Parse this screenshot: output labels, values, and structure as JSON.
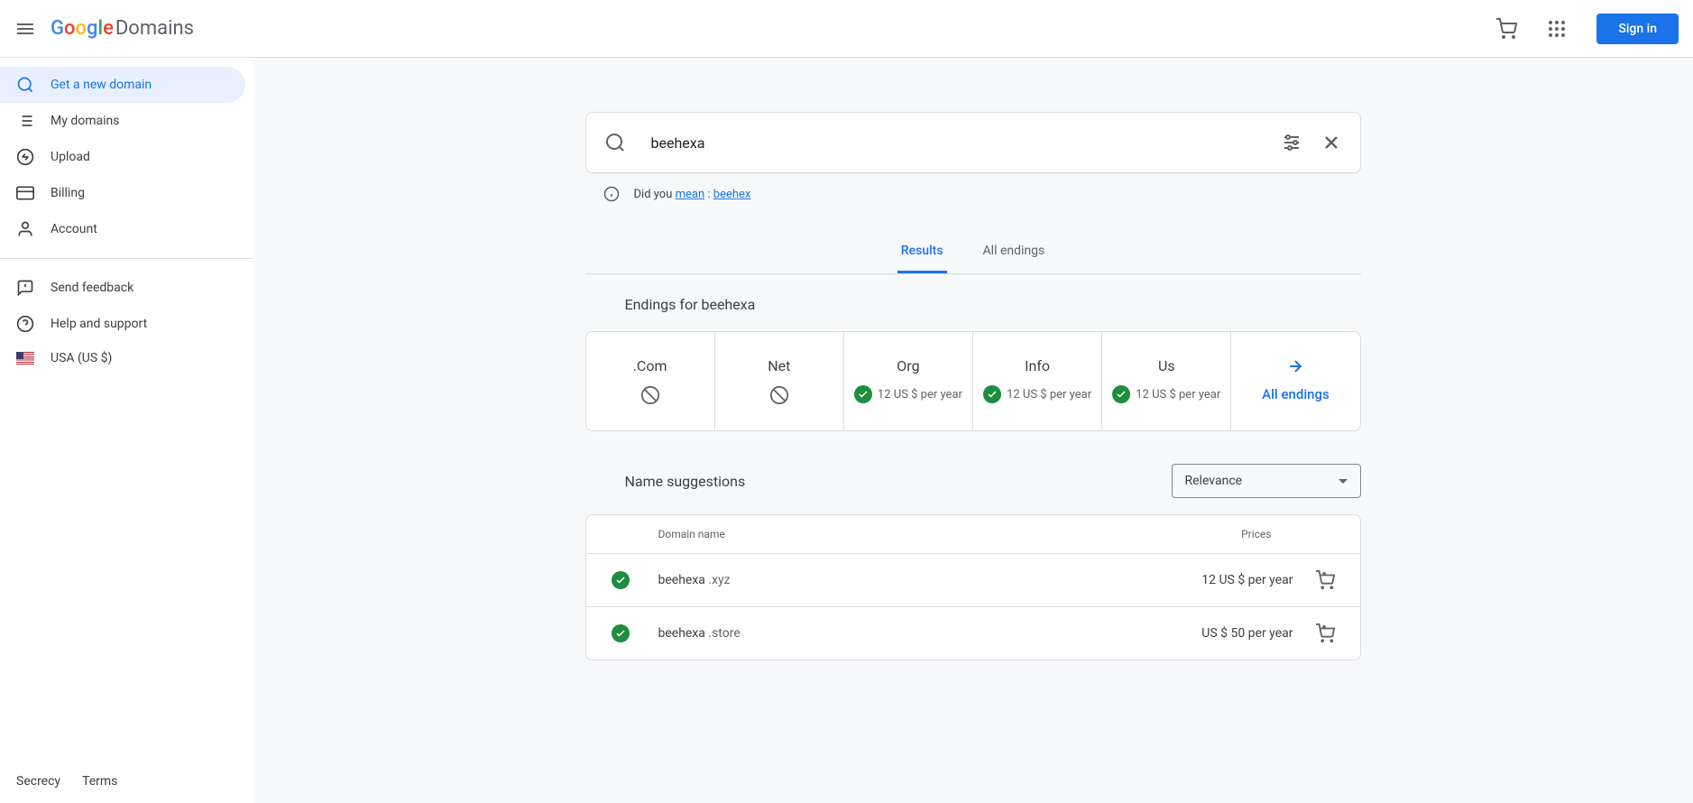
{
  "header": {
    "logo_text": "Domains",
    "signin": "Sign in"
  },
  "sidebar": {
    "items": [
      {
        "label": "Get a new domain"
      },
      {
        "label": "My domains"
      },
      {
        "label": "Upload"
      },
      {
        "label": "Billing"
      },
      {
        "label": "Account"
      }
    ],
    "secondary": [
      {
        "label": "Send feedback"
      },
      {
        "label": "Help and support"
      },
      {
        "label": "USA (US $)"
      }
    ],
    "footer": {
      "secrecy": "Secrecy",
      "terms": "Terms"
    }
  },
  "search": {
    "value": "beehexa",
    "did_you_mean_prefix": "Did you ",
    "did_you_mean_link1": "mean",
    "did_you_mean_sep": " : ",
    "did_you_mean_link2": "beehex"
  },
  "tabs": {
    "results": "Results",
    "all_endings": "All endings"
  },
  "endings": {
    "title": "Endings for beehexa",
    "items": [
      {
        "tld": ".Com",
        "available": false,
        "price": ""
      },
      {
        "tld": "Net",
        "available": false,
        "price": ""
      },
      {
        "tld": "Org",
        "available": true,
        "price": "12 US $ per year"
      },
      {
        "tld": "Info",
        "available": true,
        "price": "12 US $ per year"
      },
      {
        "tld": "Us",
        "available": true,
        "price": "12 US $ per year"
      }
    ],
    "all_endings_label": "All endings"
  },
  "suggestions": {
    "title": "Name suggestions",
    "sort": "Relevance",
    "columns": {
      "domain": "Domain name",
      "price": "Prices"
    },
    "rows": [
      {
        "name": "beehexa ",
        "tld": ".xyz",
        "price": "12 US $ per year"
      },
      {
        "name": "beehexa ",
        "tld": ".store",
        "price": "US $ 50 per year"
      }
    ]
  }
}
